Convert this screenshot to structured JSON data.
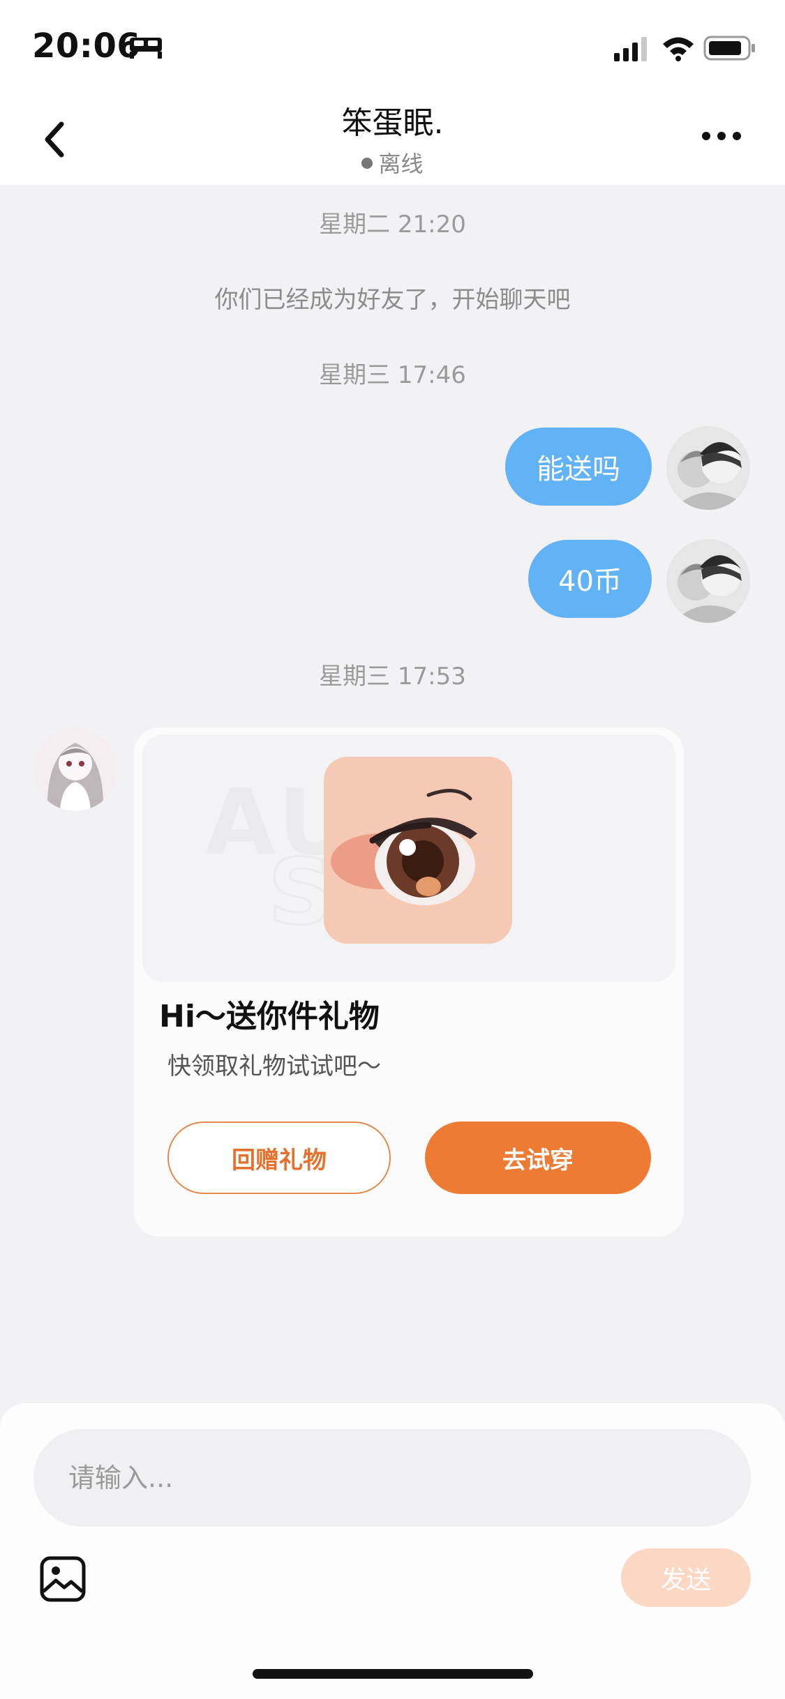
{
  "status_bar": {
    "time": "20:06"
  },
  "header": {
    "title": "笨蛋眠.",
    "status": "离线"
  },
  "timeline": {
    "ts1": "星期二 21:20",
    "system_message": "你们已经成为好友了，开始聊天吧",
    "ts2": "星期三 17:46",
    "messages": [
      "能送吗",
      "40币"
    ],
    "ts3": "星期三 17:53"
  },
  "gift_card": {
    "title": "Hi～送你件礼物",
    "subtitle": "快领取礼物试试吧～",
    "return_label": "回赠礼物",
    "try_label": "去试穿"
  },
  "composer": {
    "placeholder": "请输入...",
    "send_label": "发送"
  },
  "colors": {
    "bubble": "#62b2f6",
    "accent": "#ee7b34",
    "send_disabled": "#fbd8c3"
  }
}
